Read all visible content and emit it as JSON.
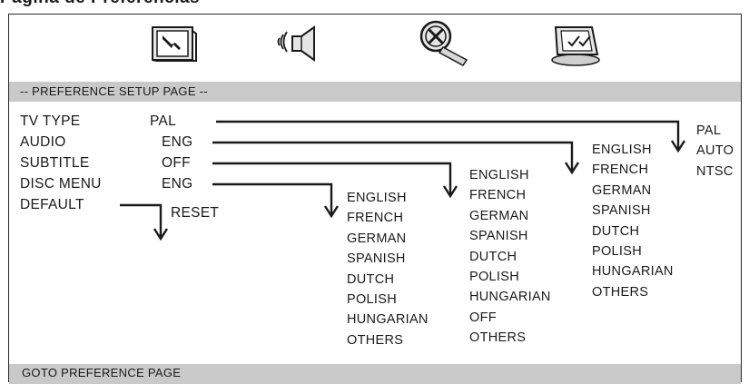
{
  "doc_heading": "Pagina de Preferencias",
  "tabs": [
    {
      "name": "general-setup-tab",
      "icon": "wrench-screen-icon"
    },
    {
      "name": "audio-setup-tab",
      "icon": "speaker-icon"
    },
    {
      "name": "video-setup-tab",
      "icon": "film-reel-icon"
    },
    {
      "name": "preference-setup-tab",
      "icon": "checklist-screen-icon"
    }
  ],
  "header": "-- PREFERENCE SETUP PAGE --",
  "status": "GOTO PREFERENCE PAGE",
  "settings": [
    {
      "label": "TV TYPE",
      "value": "PAL"
    },
    {
      "label": "AUDIO",
      "value": "ENG"
    },
    {
      "label": "SUBTITLE",
      "value": "OFF"
    },
    {
      "label": "DISC MENU",
      "value": "ENG"
    },
    {
      "label": "DEFAULT",
      "value": "RESET"
    }
  ],
  "tv_type_options": [
    "PAL",
    "AUTO",
    "NTSC"
  ],
  "audio_options": [
    "ENGLISH",
    "FRENCH",
    "GERMAN",
    "SPANISH",
    "DUTCH",
    "POLISH",
    "HUNGARIAN",
    "OTHERS"
  ],
  "subtitle_options": [
    "ENGLISH",
    "FRENCH",
    "GERMAN",
    "SPANISH",
    "DUTCH",
    "POLISH",
    "HUNGARIAN",
    "OFF",
    "OTHERS"
  ],
  "disc_menu_options": [
    "ENGLISH",
    "FRENCH",
    "GERMAN",
    "SPANISH",
    "DUTCH",
    "POLISH",
    "HUNGARIAN",
    "OTHERS"
  ]
}
